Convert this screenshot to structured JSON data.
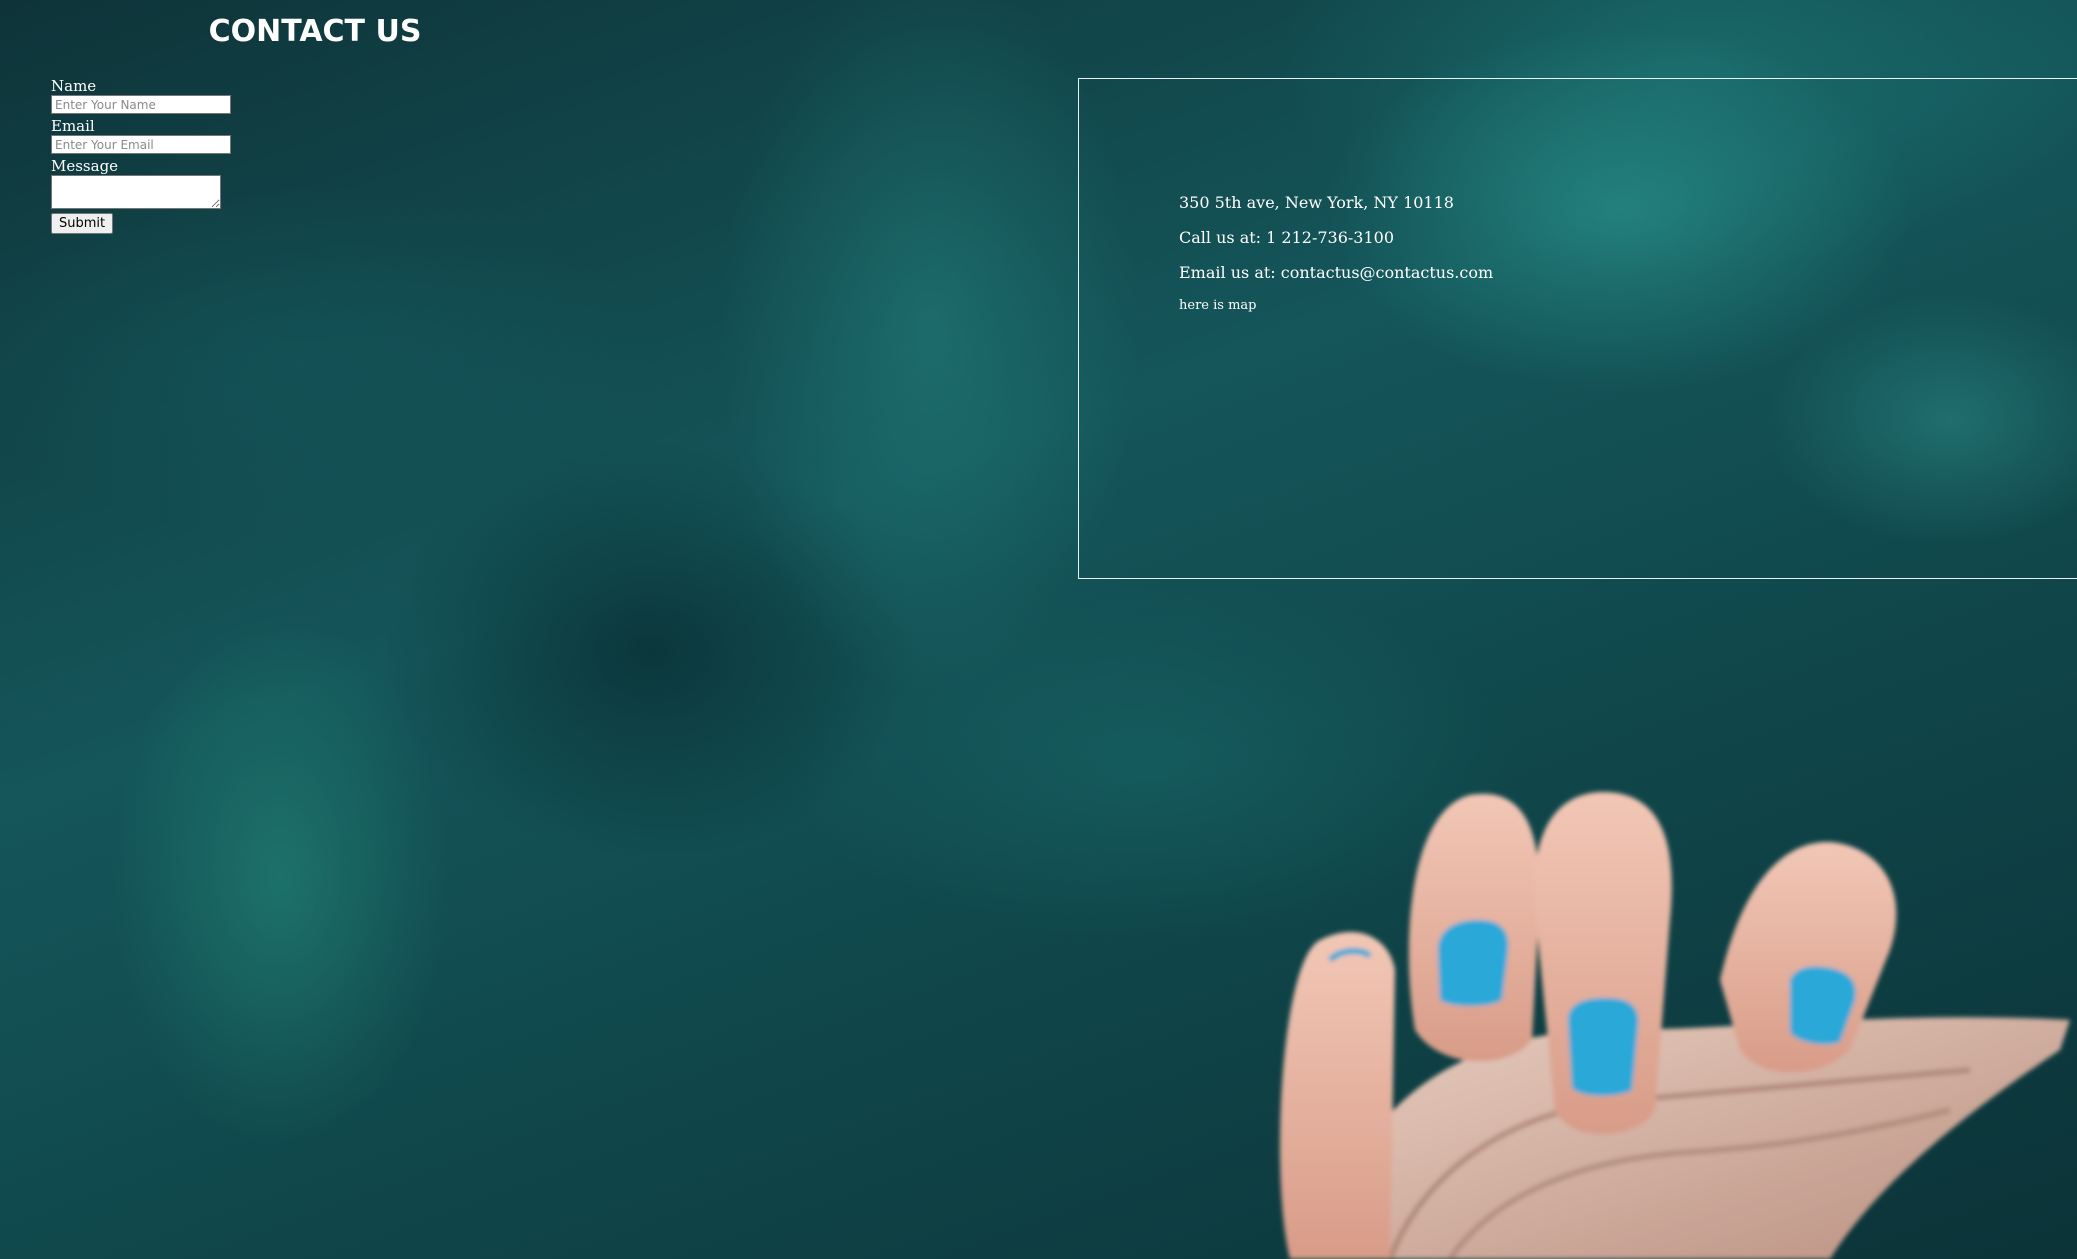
{
  "page": {
    "title": "CONTACT US"
  },
  "form": {
    "name_label": "Name",
    "name_placeholder": "Enter Your Name",
    "name_value": "",
    "email_label": "Email",
    "email_placeholder": "Enter Your Email",
    "email_value": "",
    "message_label": "Message",
    "message_value": "",
    "submit_label": "Submit"
  },
  "info": {
    "address": "350 5th ave, New York, NY 10118",
    "phone": "Call us at: 1 212-736-3100",
    "email": "Email us at: contactus@contactus.com",
    "map_note": "here is map"
  },
  "colors": {
    "background": "#0f3a40",
    "text": "#ffffff",
    "border": "#e6f2f2",
    "nail_polish": "#2aa8d8"
  },
  "icons": {
    "background_image": "hand-holding-seashell-image"
  }
}
